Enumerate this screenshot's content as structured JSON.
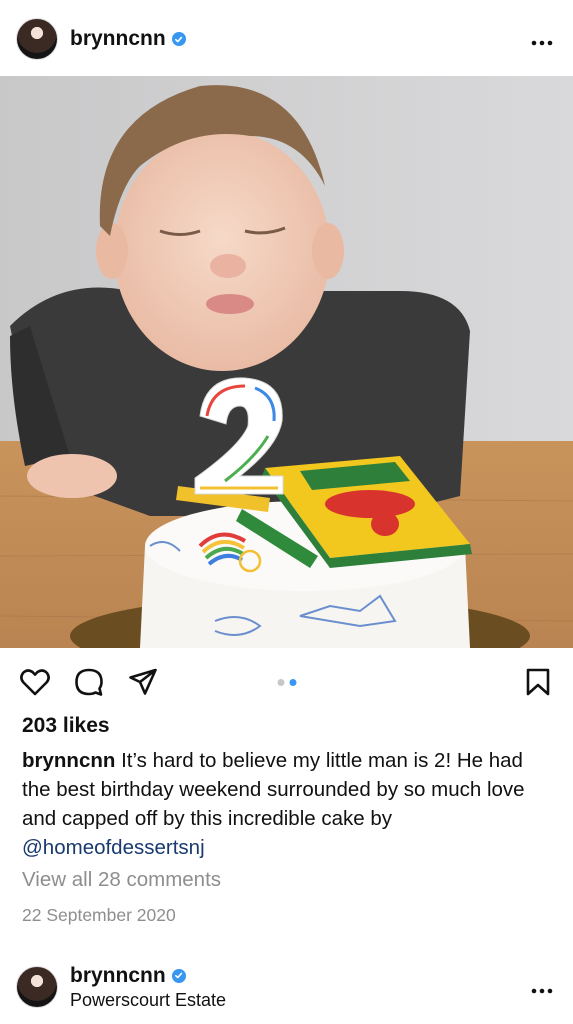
{
  "post": {
    "username": "brynncnn",
    "verified": true,
    "more_icon": "more-horizontal-icon",
    "photo_alt": "",
    "carousel": {
      "count": 2,
      "active_index": 2
    },
    "actions": {
      "like_icon": "heart-icon",
      "comment_icon": "comment-icon",
      "share_icon": "send-icon",
      "save_icon": "bookmark-icon"
    },
    "likes": "203 likes",
    "caption": {
      "username": "brynncnn",
      "text": " It’s hard to believe my little man is 2! He had the best birthday weekend surrounded by so much love and capped off by this incredible cake by ",
      "mention": "@homeofdessertsnj"
    },
    "view_comments": "View all 28 comments",
    "date": "22 September 2020"
  },
  "next_post": {
    "username": "brynncnn",
    "verified": true,
    "location": "Powerscourt Estate"
  },
  "colors": {
    "verified_blue": "#3897f0",
    "mention": "#1a3a6e",
    "muted": "#8e8e8e"
  }
}
